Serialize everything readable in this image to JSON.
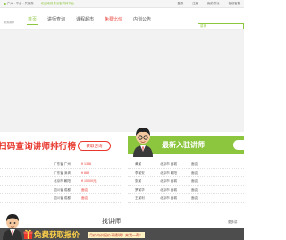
{
  "topbar": {
    "location": "广州 · 平台 · 共服务",
    "welcome": "欢迎来到易派客讲师平台",
    "links": [
      "登录",
      "注册",
      "我的易派",
      "在线客服"
    ]
  },
  "header": {
    "logo_text": "易派讲师",
    "nav": [
      "首页",
      "讲师查询",
      "课程超市",
      "免费比价",
      "内训公告"
    ],
    "search_placeholder": "讲师"
  },
  "rank_strip": {
    "title": "扫码查询讲师排行榜",
    "button": "获取咨询"
  },
  "new_strip": {
    "title": "最新入驻讲师"
  },
  "rank_list": [
    {
      "city": "广东省 广州",
      "fee": "¥ 1388"
    },
    {
      "city": "广东省 深圳",
      "fee": "¥ 888"
    },
    {
      "city": "北京市 朝阳",
      "fee": "¥ 10000元"
    },
    {
      "city": "四川省 成都",
      "fee": "面议"
    },
    {
      "city": "四川省 成都",
      "fee": "面议"
    }
  ],
  "new_list": [
    {
      "name": "黄某",
      "region": "北京市 西城",
      "fee": "面议"
    },
    {
      "name": "李某安",
      "region": "北京市 朝阳",
      "fee": "面议"
    },
    {
      "name": "张某",
      "region": "北京市 西城",
      "fee": "面议"
    },
    {
      "name": "罗某华",
      "region": "北京市 西城",
      "fee": "面议"
    },
    {
      "name": "王某利",
      "region": "北京市 西城",
      "fee": "面议"
    }
  ],
  "section_title": "找讲师",
  "side_link": "更多讲",
  "promo": {
    "main": "免费获取报价",
    "sub": "月价内训报价不透明？来我一帮！"
  },
  "colors": {
    "brand_green": "#8cc63f",
    "accent_red": "#e8382e",
    "promo_bg": "#4d4d4d",
    "promo_yellow": "#ffd24a"
  }
}
